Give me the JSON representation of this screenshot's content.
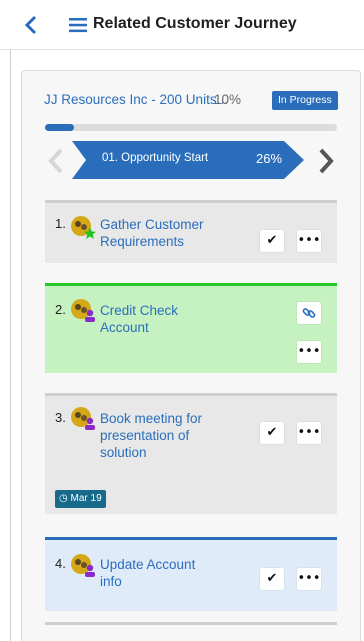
{
  "header": {
    "title": "Related Customer Journey",
    "back_icon": "chevron-left-icon",
    "menu_icon": "hamburger-menu-icon"
  },
  "journey": {
    "name": "JJ Resources Inc - 200 Units...",
    "percent": "10%",
    "status": "In Progress",
    "progress": 0.1,
    "stage": {
      "name": "01. Opportunity Start",
      "percent": "26%"
    }
  },
  "tasks": [
    {
      "number": "1.",
      "name_lines": [
        "Gather Customer",
        "Requirements"
      ],
      "actions": [
        "complete",
        "more"
      ],
      "avatar_badge": "star"
    },
    {
      "number": "2.",
      "name_lines": [
        "Credit Check",
        "Account"
      ],
      "actions": [
        "link",
        "more"
      ],
      "avatar_badge": "user"
    },
    {
      "number": "3.",
      "name_lines": [
        "Book meeting for",
        "presentation of",
        "solution"
      ],
      "actions": [
        "complete",
        "more"
      ],
      "avatar_badge": "user",
      "due_date": "Mar 19"
    },
    {
      "number": "4.",
      "name_lines": [
        "Update Account",
        "info"
      ],
      "actions": [
        "complete",
        "more"
      ],
      "avatar_badge": "user"
    }
  ],
  "icons": {
    "complete": "✔",
    "more": "•••",
    "link": "⚯"
  },
  "colors": {
    "accent": "#2a6ebb",
    "task_active_bg": "#c6f2c1",
    "task_active_border": "#28c828",
    "task_selected_bg": "#e0ebf9",
    "task_selected_border": "#2a6ebb",
    "date_badge": "#176a8a"
  }
}
